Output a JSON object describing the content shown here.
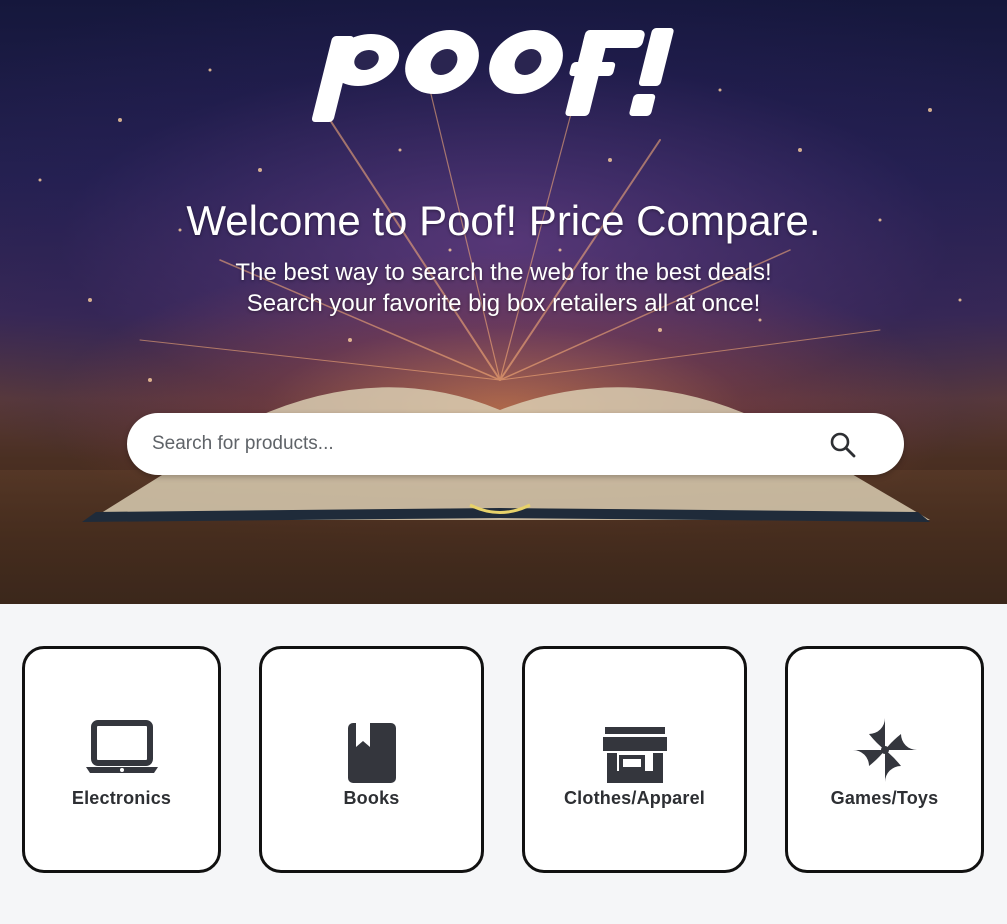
{
  "hero": {
    "logo_text": "poof!",
    "welcome": "Welcome to Poof! Price Compare.",
    "tagline_line1": "The best way to search the web for the best deals!",
    "tagline_line2": "Search your favorite big box retailers all at once!"
  },
  "search": {
    "placeholder": "Search for products...",
    "value": ""
  },
  "categories": [
    {
      "label": "Electronics",
      "icon": "laptop-icon"
    },
    {
      "label": "Books",
      "icon": "book-icon"
    },
    {
      "label": "Clothes/Apparel",
      "icon": "storefront-icon"
    },
    {
      "label": "Games/Toys",
      "icon": "pinwheel-icon"
    }
  ],
  "colors": {
    "page_background": "#f5f6f8",
    "card_border": "#111111",
    "icon_color": "#34363d",
    "hero_text": "#ffffff"
  }
}
